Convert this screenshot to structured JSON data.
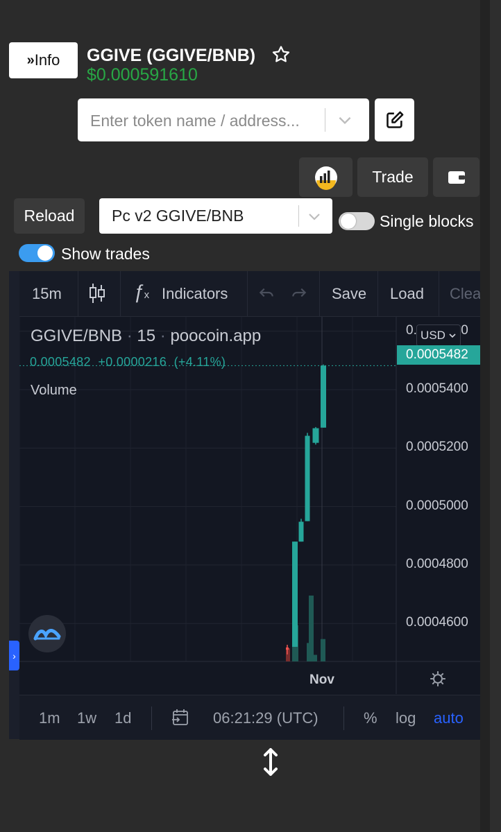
{
  "header": {
    "info_button": "Info",
    "token_title": "GGIVE (GGIVE/BNB)",
    "token_price": "$0.000591610",
    "colors": {
      "price": "#28a745"
    }
  },
  "search": {
    "placeholder": "Enter token name / address..."
  },
  "actions": {
    "trade_label": "Trade",
    "reload_label": "Reload",
    "pair_selected": "Pc v2 GGIVE/BNB",
    "single_blocks_label": "Single blocks",
    "single_blocks_on": false,
    "show_trades_label": "Show trades",
    "show_trades_on": true
  },
  "chart_toolbar": {
    "interval": "15m",
    "indicators": "Indicators",
    "save": "Save",
    "load": "Load",
    "clear": "Clea"
  },
  "chart_legend": {
    "symbol": "GGIVE/BNB",
    "interval": "15",
    "source": "poocoin.app",
    "last": "0.0005482",
    "change": "+0.0000216",
    "change_pct": "(+4.11%)",
    "volume_label": "Volume",
    "currency": "USD"
  },
  "chart_data": {
    "type": "candlestick",
    "price_axis_ticks": [
      "0.0005600",
      "0.0005400",
      "0.0005200",
      "0.0005000",
      "0.0004800",
      "0.0004600"
    ],
    "last_price_tag": "0.0005482",
    "x_tick_labels": [
      "Nov"
    ],
    "ylim": [
      0.000447,
      0.000563
    ],
    "candles": [
      {
        "open": 0.0004518,
        "high": 0.0004527,
        "low": 0.0004494,
        "close": 0.000451,
        "dir": "down"
      },
      {
        "open": 0.000452,
        "high": 0.000488,
        "low": 0.000452,
        "close": 0.000488,
        "dir": "up"
      },
      {
        "open": 0.000488,
        "high": 0.0004958,
        "low": 0.000488,
        "close": 0.0004948,
        "dir": "up"
      },
      {
        "open": 0.000495,
        "high": 0.0005252,
        "low": 0.000495,
        "close": 0.0005242,
        "dir": "up"
      },
      {
        "open": 0.0005218,
        "high": 0.0005272,
        "low": 0.0005212,
        "close": 0.0005268,
        "dir": "up"
      },
      {
        "open": 0.000527,
        "high": 0.0005486,
        "low": 0.000527,
        "close": 0.0005482,
        "dir": "up"
      }
    ],
    "volume_relative": [
      0.2,
      0.55,
      0.28,
      1.0,
      0.1,
      0.34
    ],
    "colors": {
      "up": "#26a69a",
      "down": "#ef5350"
    }
  },
  "chart_bottombar": {
    "range_1m": "1m",
    "range_1w": "1w",
    "range_1d": "1d",
    "time": "06:21:29 (UTC)",
    "percent": "%",
    "log": "log",
    "auto": "auto",
    "colors": {
      "auto": "#2962ff"
    }
  }
}
